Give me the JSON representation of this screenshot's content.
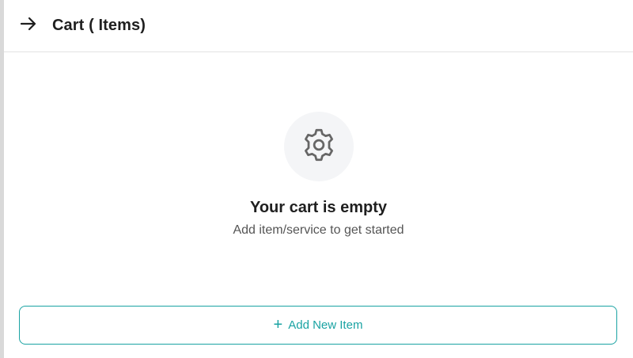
{
  "header": {
    "back_icon": "arrow-right-icon",
    "title": "Cart ( Items)"
  },
  "empty_state": {
    "icon": "gear-icon",
    "title": "Your cart is empty",
    "subtitle": "Add item/service to get started"
  },
  "actions": {
    "add_icon": "plus-icon",
    "add_label": "Add New Item"
  },
  "colors": {
    "accent": "#1aa3a3",
    "icon_bg": "#f4f5f7",
    "divider": "#e2e2e2",
    "left_border": "#d9d9d9"
  }
}
